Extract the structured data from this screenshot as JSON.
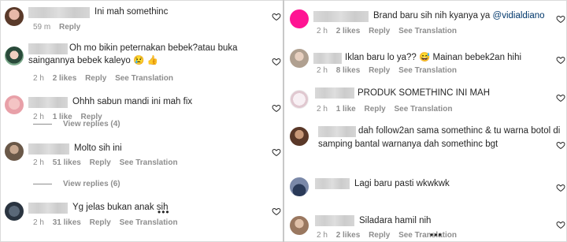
{
  "left": {
    "comments": [
      {
        "text": "Ini mah somethinc",
        "time": "59 m",
        "reply": "Reply"
      },
      {
        "text_line1": "Oh mo bikin peternakan bebek?atau buka",
        "text_line2": "saingannya bebek kaleyo",
        "emoji": "😢 👍",
        "time": "2 h",
        "likes": "2 likes",
        "reply": "Reply",
        "see_translation": "See Translation"
      },
      {
        "text": "Ohhh sabun mandi ini mah fix",
        "time": "2 h",
        "likes": "1 like",
        "reply": "Reply",
        "view_replies": "View replies (4)"
      },
      {
        "text": "Molto sih ini",
        "time": "2 h",
        "likes": "51 likes",
        "reply": "Reply",
        "see_translation": "See Translation",
        "view_replies": "View replies (6)"
      },
      {
        "text": "Yg jelas bukan anak sih",
        "time": "2 h",
        "likes": "31 likes",
        "reply": "Reply",
        "see_translation": "See Translation"
      }
    ]
  },
  "right": {
    "comments": [
      {
        "text": "Brand baru sih nih kyanya ya",
        "mention": "@vidialdiano",
        "time": "2 h",
        "likes": "2 likes",
        "reply": "Reply",
        "see_translation": "See Translation"
      },
      {
        "text": "Iklan baru lo ya??",
        "emoji": "😅",
        "text2": "Mainan bebek2an hihi",
        "time": "2 h",
        "likes": "8 likes",
        "reply": "Reply",
        "see_translation": "See Translation"
      },
      {
        "text": "PRODUK SOMETHINC INI MAH",
        "time": "2 h",
        "likes": "1 like",
        "reply": "Reply",
        "see_translation": "See Translation"
      },
      {
        "text_line1": "dah follow2an sama somethinc & tu warna botol di",
        "text_line2": "samping bantal warnanya dah somethinc bgt"
      },
      {
        "text": "Lagi baru pasti wkwkwk"
      },
      {
        "text": "Siladara hamil nih",
        "time": "2 h",
        "likes": "2 likes",
        "reply": "Reply",
        "see_translation": "See Translation"
      }
    ]
  },
  "icons": {
    "like": "heart-icon",
    "more": "more-icon"
  },
  "colors": {
    "meta": "#8e8e8e",
    "mention": "#00376b",
    "text": "#262626",
    "divider": "#c8c8c8"
  }
}
